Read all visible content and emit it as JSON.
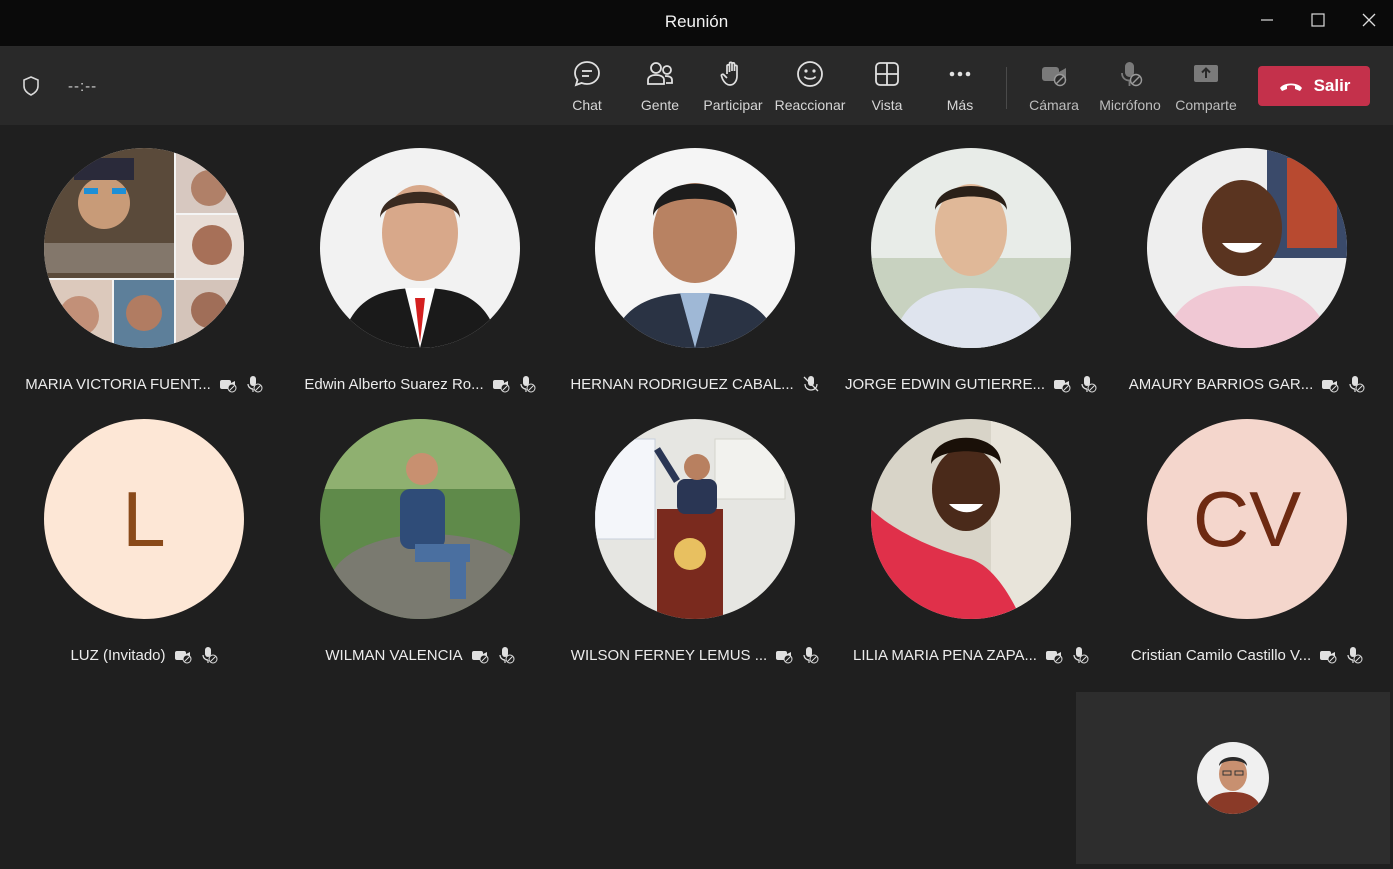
{
  "window": {
    "title": "Reunión"
  },
  "toolbar": {
    "timer": "--:--",
    "chat": "Chat",
    "people": "Gente",
    "raise_hand": "Participar",
    "react": "Reaccionar",
    "view": "Vista",
    "more": "Más",
    "camera": "Cámara",
    "mic": "Micrófono",
    "share": "Comparte",
    "leave": "Salir"
  },
  "participants": [
    {
      "name": "MARIA VICTORIA FUENT...",
      "initials": ""
    },
    {
      "name": "Edwin Alberto Suarez Ro...",
      "initials": ""
    },
    {
      "name": "HERNAN RODRIGUEZ CABAL...",
      "initials": ""
    },
    {
      "name": "JORGE EDWIN GUTIERRE...",
      "initials": ""
    },
    {
      "name": "AMAURY BARRIOS GAR...",
      "initials": ""
    },
    {
      "name": "LUZ (Invitado)",
      "initials": "L"
    },
    {
      "name": "WILMAN VALENCIA",
      "initials": ""
    },
    {
      "name": "WILSON FERNEY LEMUS ...",
      "initials": ""
    },
    {
      "name": "LILIA MARIA PENA ZAPA...",
      "initials": ""
    },
    {
      "name": "Cristian Camilo Castillo V...",
      "initials": "CV"
    }
  ],
  "colors": {
    "leave": "#c4314b",
    "toolbar": "#292929",
    "stage": "#1f1f1f"
  }
}
